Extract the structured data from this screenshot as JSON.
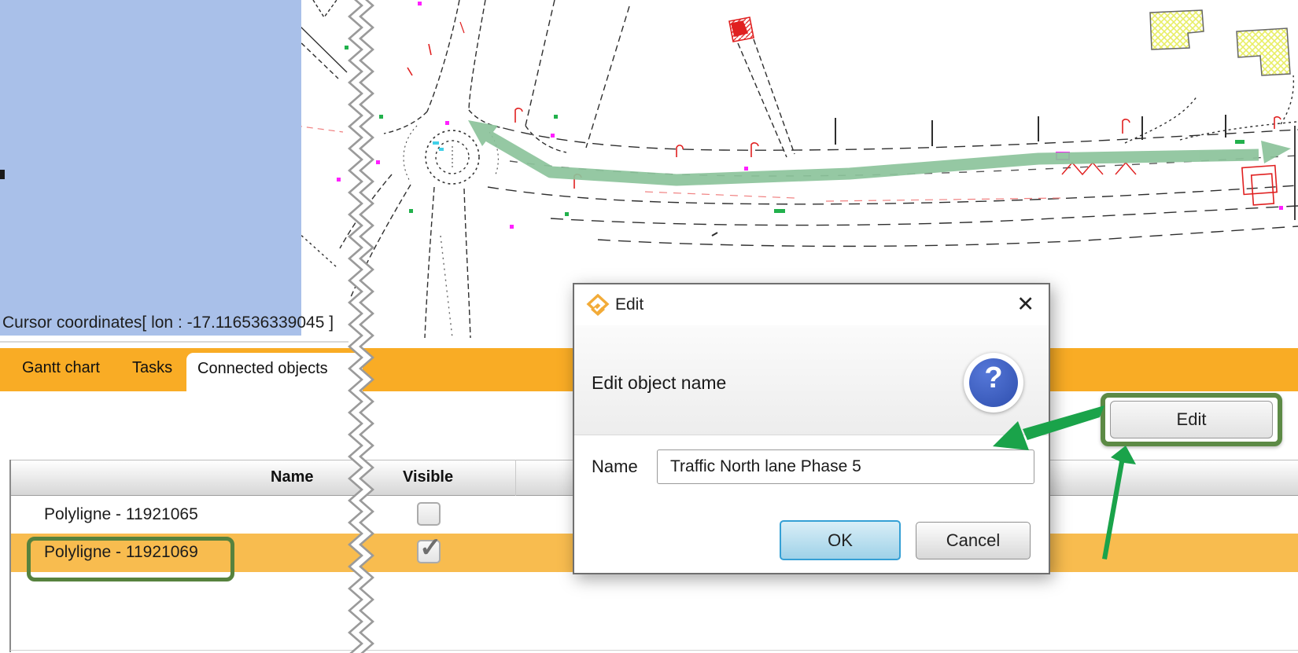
{
  "map": {
    "cursor_text": "Cursor coordinates[ lon : -17.116536339045 ]",
    "route_color": "#8CC39B",
    "panel_color": "#A9C0E9"
  },
  "tabs": {
    "bar_color": "#F9AC25",
    "items": [
      {
        "label": "Gantt chart"
      },
      {
        "label": "Tasks"
      },
      {
        "label": "Connected objects",
        "active": true
      }
    ]
  },
  "table": {
    "headers": {
      "name": "Name",
      "visible": "Visible"
    },
    "highlight_color": "#F8BC4F",
    "rows": [
      {
        "name": "Polyligne - 11921065",
        "visible": false,
        "check_glyph": ""
      },
      {
        "name": "Polyligne - 11921069",
        "visible": true,
        "check_glyph": "✓",
        "highlighted": true
      }
    ]
  },
  "edit_button": {
    "label": "Edit"
  },
  "annotations": {
    "box_color": "#57823E",
    "arrow_color": "#1AA34A"
  },
  "dialog": {
    "title": "Edit",
    "close_glyph": "✕",
    "message": "Edit object name",
    "help_glyph": "?",
    "help_color": "#3B5CC0",
    "name_label": "Name",
    "name_value": "Traffic North lane Phase 5",
    "ok_label": "OK",
    "cancel_label": "Cancel",
    "ok_border_color": "#35A0D5"
  }
}
